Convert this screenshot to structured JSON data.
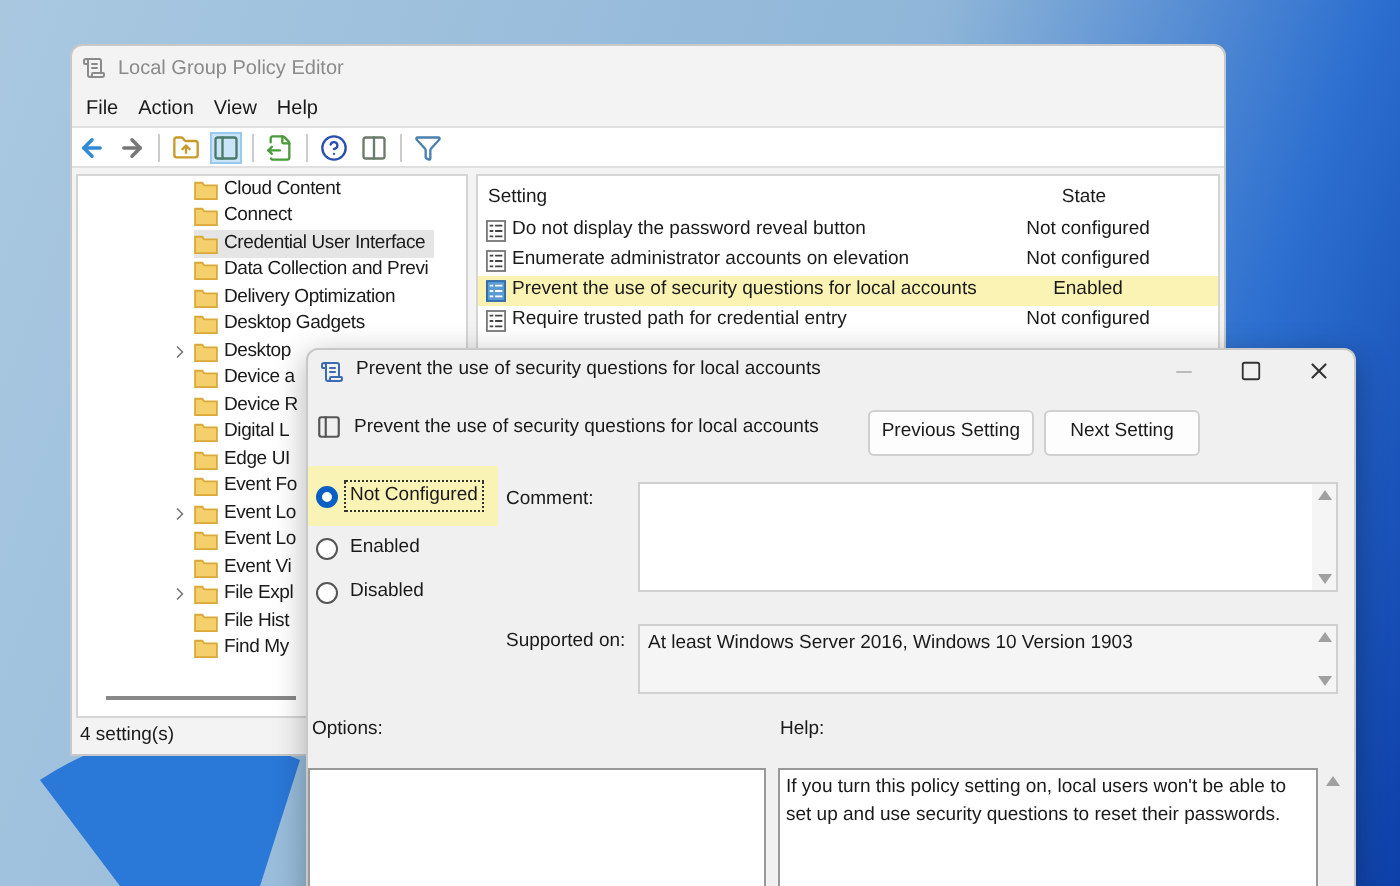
{
  "main_window": {
    "title": "Local Group Policy Editor",
    "menu": [
      "File",
      "Action",
      "View",
      "Help"
    ],
    "tree": [
      {
        "label": "Cloud Content",
        "expandable": false,
        "selected": false
      },
      {
        "label": "Connect",
        "expandable": false,
        "selected": false
      },
      {
        "label": "Credential User Interface",
        "expandable": false,
        "selected": true
      },
      {
        "label": "Data Collection and Previ",
        "expandable": false,
        "selected": false
      },
      {
        "label": "Delivery Optimization",
        "expandable": false,
        "selected": false
      },
      {
        "label": "Desktop Gadgets",
        "expandable": false,
        "selected": false
      },
      {
        "label": "Desktop",
        "expandable": true,
        "selected": false
      },
      {
        "label": "Device a",
        "expandable": false,
        "selected": false
      },
      {
        "label": "Device R",
        "expandable": false,
        "selected": false
      },
      {
        "label": "Digital L",
        "expandable": false,
        "selected": false
      },
      {
        "label": "Edge UI",
        "expandable": false,
        "selected": false
      },
      {
        "label": "Event Fo",
        "expandable": false,
        "selected": false
      },
      {
        "label": "Event Lo",
        "expandable": true,
        "selected": false
      },
      {
        "label": "Event Lo",
        "expandable": false,
        "selected": false
      },
      {
        "label": "Event Vi",
        "expandable": false,
        "selected": false
      },
      {
        "label": "File Expl",
        "expandable": true,
        "selected": false
      },
      {
        "label": "File Hist",
        "expandable": false,
        "selected": false
      },
      {
        "label": "Find My",
        "expandable": false,
        "selected": false
      }
    ],
    "columns": [
      "Setting",
      "State"
    ],
    "rows": [
      {
        "setting": "Do not display the password reveal button",
        "state": "Not configured",
        "selected": false
      },
      {
        "setting": "Enumerate administrator accounts on elevation",
        "state": "Not configured",
        "selected": false
      },
      {
        "setting": "Prevent the use of security questions for local accounts",
        "state": "Enabled",
        "selected": true
      },
      {
        "setting": "Require trusted path for credential entry",
        "state": "Not configured",
        "selected": false
      }
    ],
    "status_bar": "4 setting(s)"
  },
  "dialog": {
    "title": "Prevent the use of security questions for local accounts",
    "policy_name": "Prevent the use of security questions for local accounts",
    "buttons": [
      "Previous Setting",
      "Next Setting"
    ],
    "options": [
      {
        "label": "Not Configured",
        "selected": true
      },
      {
        "label": "Enabled",
        "selected": false
      },
      {
        "label": "Disabled",
        "selected": false
      }
    ],
    "comment_label": "Comment:",
    "supported_label": "Supported on:",
    "supported_text": "At least Windows Server 2016, Windows 10 Version 1903",
    "options_label": "Options:",
    "help_label": "Help:",
    "help_text": "If you turn this policy setting on, local users won't be able to set up and use security questions to reset their passwords."
  }
}
